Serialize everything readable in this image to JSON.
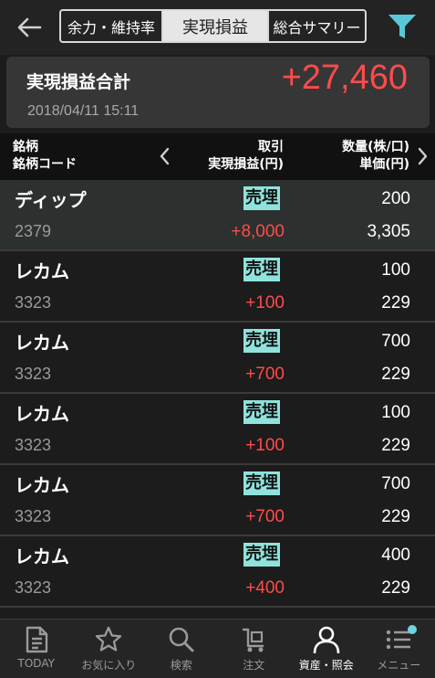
{
  "header": {
    "tabs": [
      "余力・維持率",
      "実現損益",
      "総合サマリー"
    ],
    "active_tab": "実現損益"
  },
  "summary": {
    "label": "実現損益合計",
    "value": "+27,460",
    "datetime": "2018/04/11  15:11"
  },
  "columns": {
    "left_line1": "銘柄",
    "left_line2": "銘柄コード",
    "mid_line1": "取引",
    "mid_line2": "実現損益(円)",
    "right_line1": "数量(株/口)",
    "right_line2": "単価(円)"
  },
  "rows": [
    {
      "name": "ディップ",
      "code": "2379",
      "trade": "売埋",
      "pnl": "+8,000",
      "qty": "200",
      "price": "3,305"
    },
    {
      "name": "レカム",
      "code": "3323",
      "trade": "売埋",
      "pnl": "+100",
      "qty": "100",
      "price": "229"
    },
    {
      "name": "レカム",
      "code": "3323",
      "trade": "売埋",
      "pnl": "+700",
      "qty": "700",
      "price": "229"
    },
    {
      "name": "レカム",
      "code": "3323",
      "trade": "売埋",
      "pnl": "+100",
      "qty": "100",
      "price": "229"
    },
    {
      "name": "レカム",
      "code": "3323",
      "trade": "売埋",
      "pnl": "+700",
      "qty": "700",
      "price": "229"
    },
    {
      "name": "レカム",
      "code": "3323",
      "trade": "売埋",
      "pnl": "+400",
      "qty": "400",
      "price": "229"
    }
  ],
  "nav": [
    {
      "label": "TODAY",
      "icon": "document-icon"
    },
    {
      "label": "お気に入り",
      "icon": "star-icon"
    },
    {
      "label": "検索",
      "icon": "search-icon"
    },
    {
      "label": "注文",
      "icon": "cart-icon"
    },
    {
      "label": "資産・照会",
      "icon": "person-icon",
      "active": true
    },
    {
      "label": "メニュー",
      "icon": "menu-icon"
    }
  ],
  "colors": {
    "positive": "#ff4b4b",
    "trade_badge": "#8fe3dc",
    "accent": "#6fd3e0"
  }
}
